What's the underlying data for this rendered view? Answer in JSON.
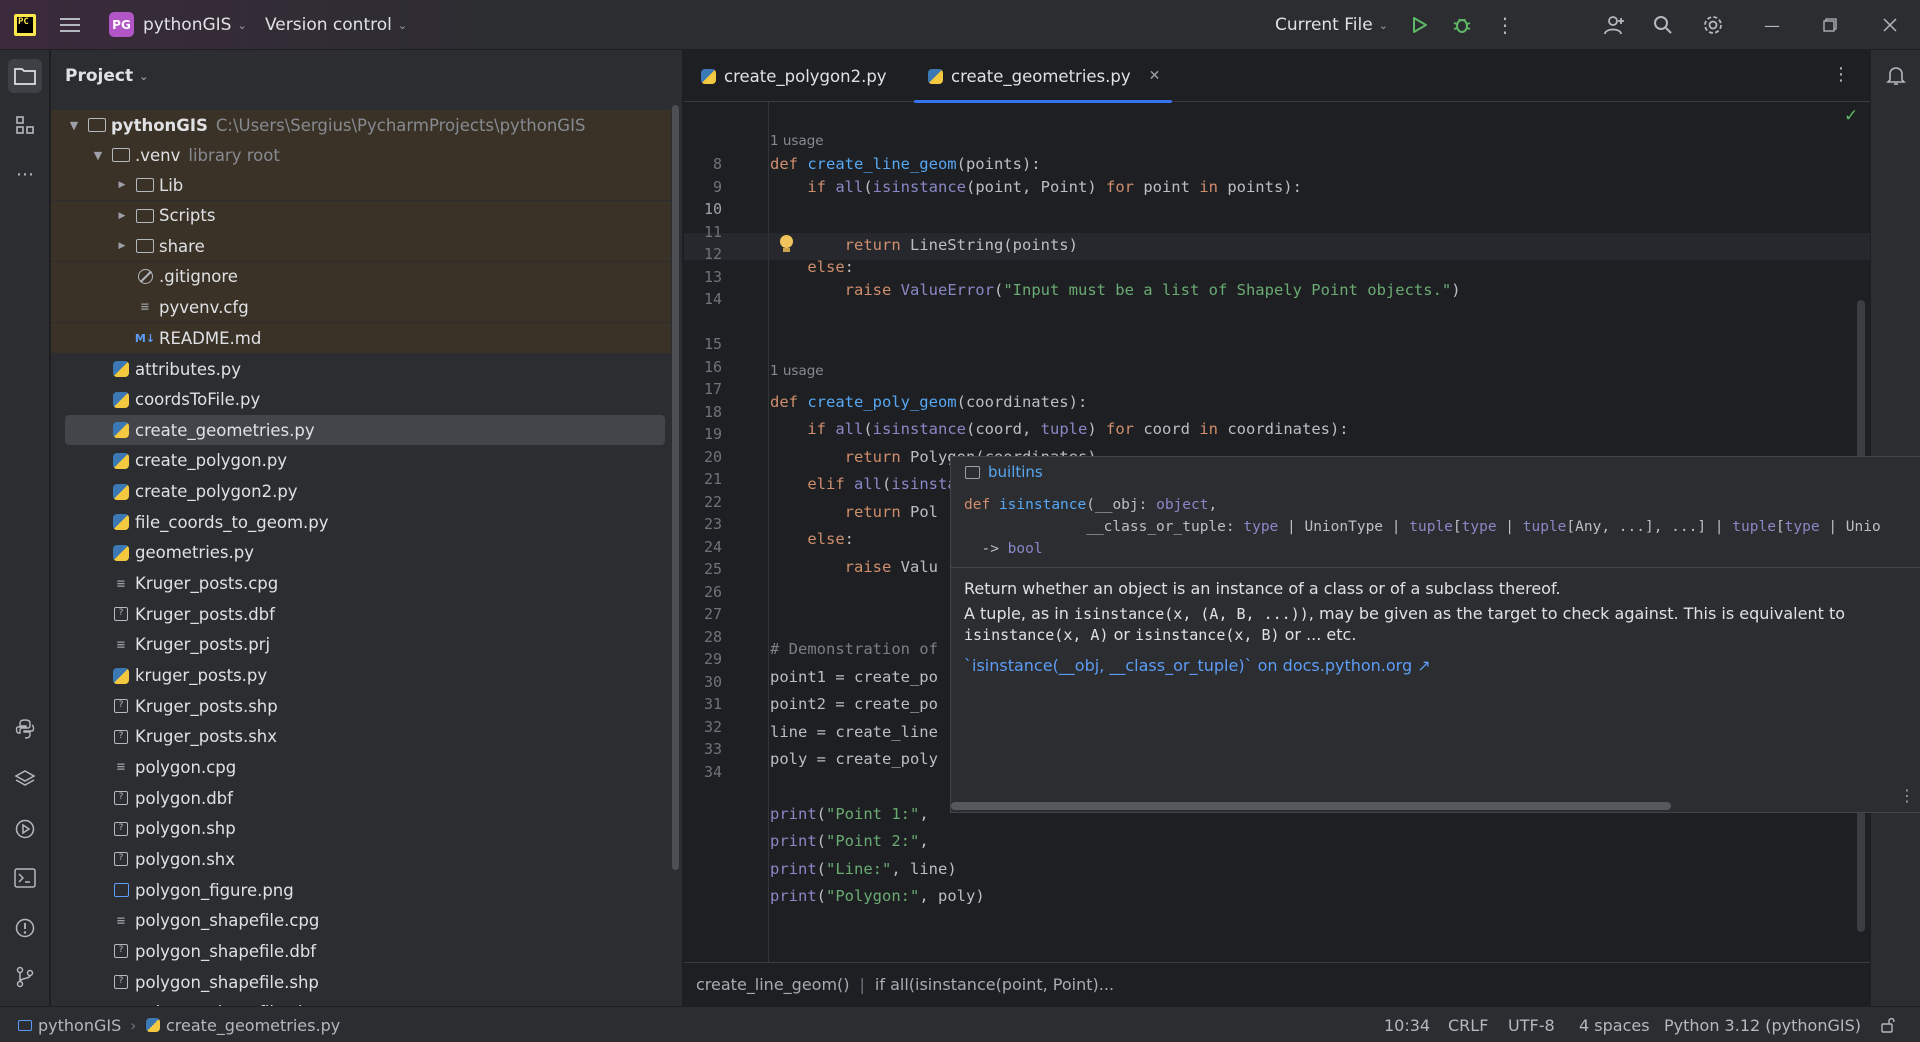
{
  "titlebar": {
    "project_initials": "PG",
    "project_name": "pythonGIS",
    "vcs_label": "Version control",
    "run_config": "Current File"
  },
  "icons": {
    "app": "pycharm-logo-icon",
    "menu": "hamburger-menu-icon",
    "run": "run-icon",
    "debug": "debug-icon",
    "more": "more-vertical-icon",
    "add_user": "add-user-icon",
    "search": "search-icon",
    "settings": "gear-icon"
  },
  "project_panel": {
    "title": "Project",
    "root_name": "pythonGIS",
    "root_path": "C:\\Users\\Sergius\\PycharmProjects\\pythonGIS",
    "venv_name": ".venv",
    "venv_note": "library root",
    "venv_children": [
      {
        "name": "Lib",
        "type": "folder"
      },
      {
        "name": "Scripts",
        "type": "folder"
      },
      {
        "name": "share",
        "type": "folder"
      },
      {
        "name": ".gitignore",
        "type": "ignore"
      },
      {
        "name": "pyvenv.cfg",
        "type": "text"
      },
      {
        "name": "README.md",
        "type": "markdown"
      }
    ],
    "files": [
      {
        "name": "attributes.py",
        "type": "python"
      },
      {
        "name": "coordsToFile.py",
        "type": "python"
      },
      {
        "name": "create_geometries.py",
        "type": "python",
        "selected": true
      },
      {
        "name": "create_polygon.py",
        "type": "python"
      },
      {
        "name": "create_polygon2.py",
        "type": "python"
      },
      {
        "name": "file_coords_to_geom.py",
        "type": "python"
      },
      {
        "name": "geometries.py",
        "type": "python"
      },
      {
        "name": "Kruger_posts.cpg",
        "type": "text"
      },
      {
        "name": "Kruger_posts.dbf",
        "type": "unknown"
      },
      {
        "name": "Kruger_posts.prj",
        "type": "text"
      },
      {
        "name": "kruger_posts.py",
        "type": "python"
      },
      {
        "name": "Kruger_posts.shp",
        "type": "unknown"
      },
      {
        "name": "Kruger_posts.shx",
        "type": "unknown"
      },
      {
        "name": "polygon.cpg",
        "type": "text"
      },
      {
        "name": "polygon.dbf",
        "type": "unknown"
      },
      {
        "name": "polygon.shp",
        "type": "unknown"
      },
      {
        "name": "polygon.shx",
        "type": "unknown"
      },
      {
        "name": "polygon_figure.png",
        "type": "image"
      },
      {
        "name": "polygon_shapefile.cpg",
        "type": "text"
      },
      {
        "name": "polygon_shapefile.dbf",
        "type": "unknown"
      },
      {
        "name": "polygon_shapefile.shp",
        "type": "unknown"
      },
      {
        "name": "polygon_shapefile.shx",
        "type": "unknown"
      }
    ]
  },
  "editor": {
    "tabs": [
      {
        "label": "create_polygon2.py",
        "active": false
      },
      {
        "label": "create_geometries.py",
        "active": true
      }
    ],
    "usage_label": "1 usage",
    "current_line": 10,
    "line_numbers": [
      "8",
      "9",
      "10",
      "11",
      "12",
      "13",
      "14",
      "15",
      "16",
      "17",
      "18",
      "19",
      "20",
      "21",
      "22",
      "23",
      "24",
      "25",
      "26",
      "27",
      "28",
      "29",
      "30",
      "31",
      "32",
      "33",
      "34"
    ],
    "breadcrumbs": [
      "create_line_geom()",
      "if all(isinstance(point, Point)..."
    ]
  },
  "quick_doc": {
    "module": "builtins",
    "signature_line1_def": "def",
    "signature_line1_name": "isinstance",
    "signature_line1_rest": "(__obj: ",
    "signature_obj_type": "object",
    "signature_line2_param": "              __class_or_tuple: ",
    "signature_line3": "  -> ",
    "signature_return": "bool",
    "summary": "Return whether an object is an instance of a class or of a subclass thereof.",
    "detail_line1_pre": "A tuple, as in ",
    "detail_line1_code": "isinstance(x, (A, B, ...))",
    "detail_line1_post": ", may be given as the target to check against. This is equivalent to",
    "detail_line2_code1": "isinstance(x, A)",
    "detail_line2_mid": " or ",
    "detail_line2_code2": "isinstance(x, B)",
    "detail_line2_post": " or ... etc.",
    "link": "`isinstance(__obj, __class_or_tuple)` on docs.python.org ↗"
  },
  "statusbar": {
    "project": "pythonGIS",
    "file": "create_geometries.py",
    "position": "10:34",
    "line_endings": "CRLF",
    "encoding": "UTF-8",
    "indent": "4 spaces",
    "interpreter": "Python 3.12 (pythonGIS)"
  },
  "colors": {
    "keyword": "#cf8e6d",
    "function": "#56a8f5",
    "builtin": "#8888c6",
    "string": "#6aab73",
    "accent": "#3574f0",
    "project_badge": "#b256c7"
  }
}
